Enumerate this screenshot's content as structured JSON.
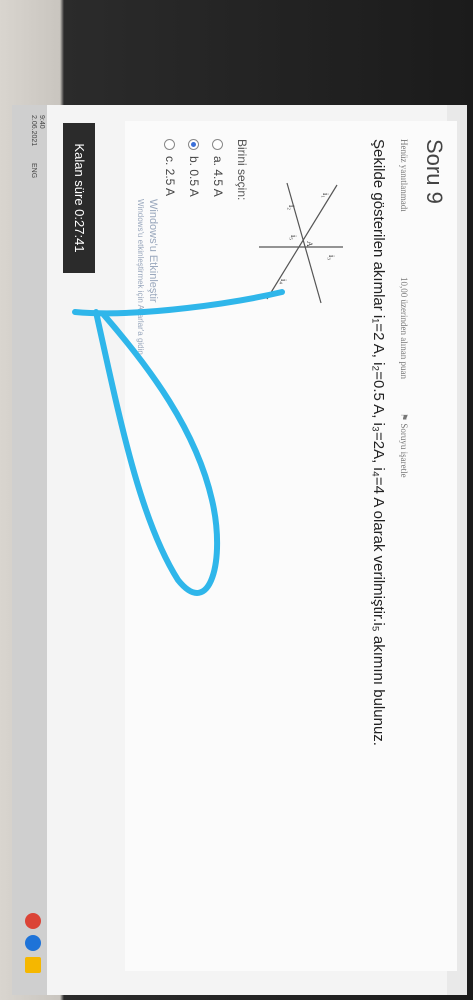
{
  "quiz": {
    "title": "Soru 9",
    "status": "Henüz yanıtlanmadı",
    "score": "10,00 üzerinden alınan puan",
    "flag": "Soruyu işaretle",
    "question": "Şekilde gösterilen akımlar i₁=2 A, i₂=0.5 A, i₃=2A, i₄=4 A olarak verilmiştir.i₅ akımını bulunuz.",
    "prompt": "Birini seçin:",
    "options": [
      {
        "label": "a. 4.5 A",
        "selected": false
      },
      {
        "label": "b. 0.5 A",
        "selected": true
      },
      {
        "label": "c. 2.5 A",
        "selected": false
      }
    ],
    "watermark_1": "Windows'u Etkinleştir",
    "watermark_2": "Windows'u etkinleştirmek için Ayarlar'a gidin."
  },
  "diagram": {
    "labels": [
      "i₁",
      "i₂",
      "i₃",
      "i₄",
      "i₅",
      "A"
    ]
  },
  "timer": {
    "text": "Kalan süre 0:27:41"
  },
  "taskbar": {
    "lang": "ENG",
    "time": "9:40",
    "date": "2.06.2021"
  },
  "colors": {
    "annotation": "#2fb6ea",
    "selected_radio": "#3a6fd8"
  }
}
